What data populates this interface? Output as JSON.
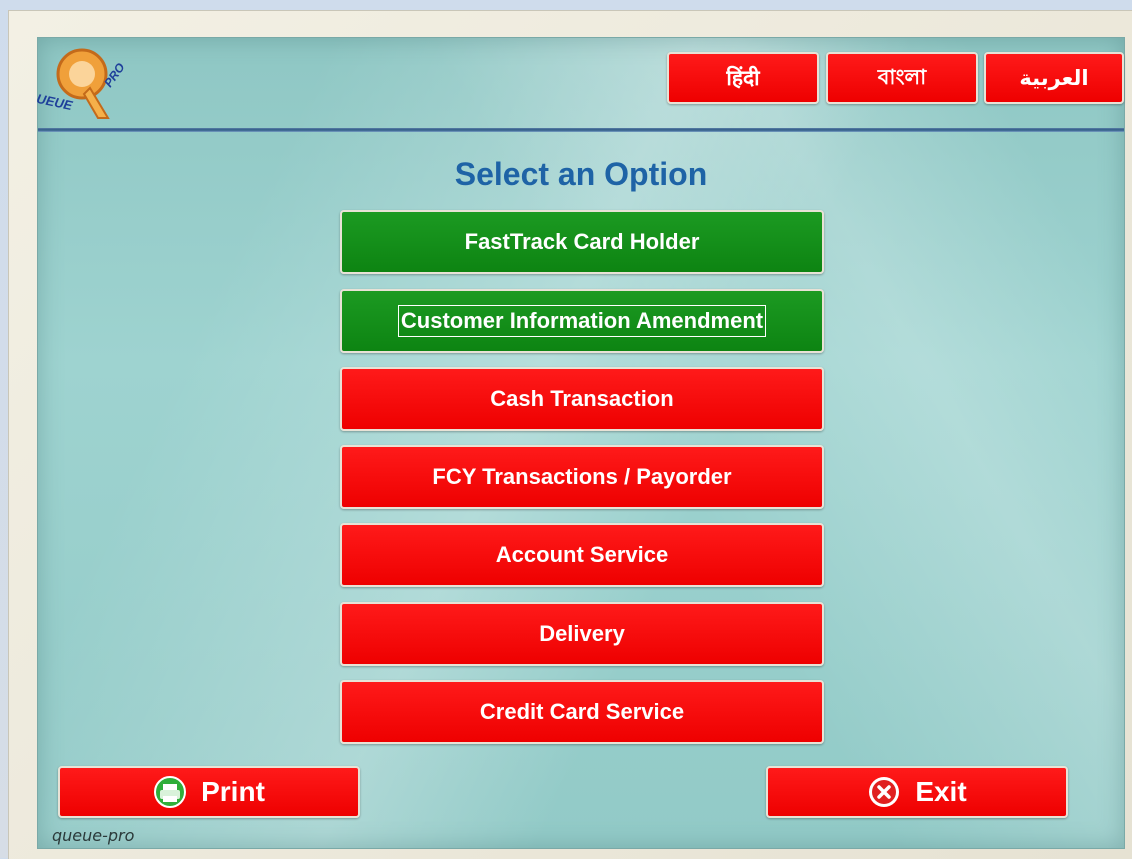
{
  "header": {
    "logo_text": "QUEUE PRO",
    "languages": [
      {
        "label": "हिंदी"
      },
      {
        "label": "বাংলা"
      },
      {
        "label": "العربية"
      }
    ]
  },
  "main": {
    "title": "Select an Option",
    "options": [
      {
        "label": "FastTrack Card Holder",
        "color": "#129016"
      },
      {
        "label": "Customer Information Amendment",
        "color": "#129016"
      },
      {
        "label": "Cash Transaction",
        "color": "#ff0000"
      },
      {
        "label": "FCY Transactions / Payorder",
        "color": "#ff0000"
      },
      {
        "label": "Account Service",
        "color": "#ff0000"
      },
      {
        "label": "Delivery",
        "color": "#ff0000"
      },
      {
        "label": "Credit Card Service",
        "color": "#ff0000"
      }
    ]
  },
  "footer": {
    "print_label": "Print",
    "print_icon": "printer-icon",
    "exit_label": "Exit",
    "exit_icon": "close-circle-icon",
    "app_label": "queue-pro"
  }
}
